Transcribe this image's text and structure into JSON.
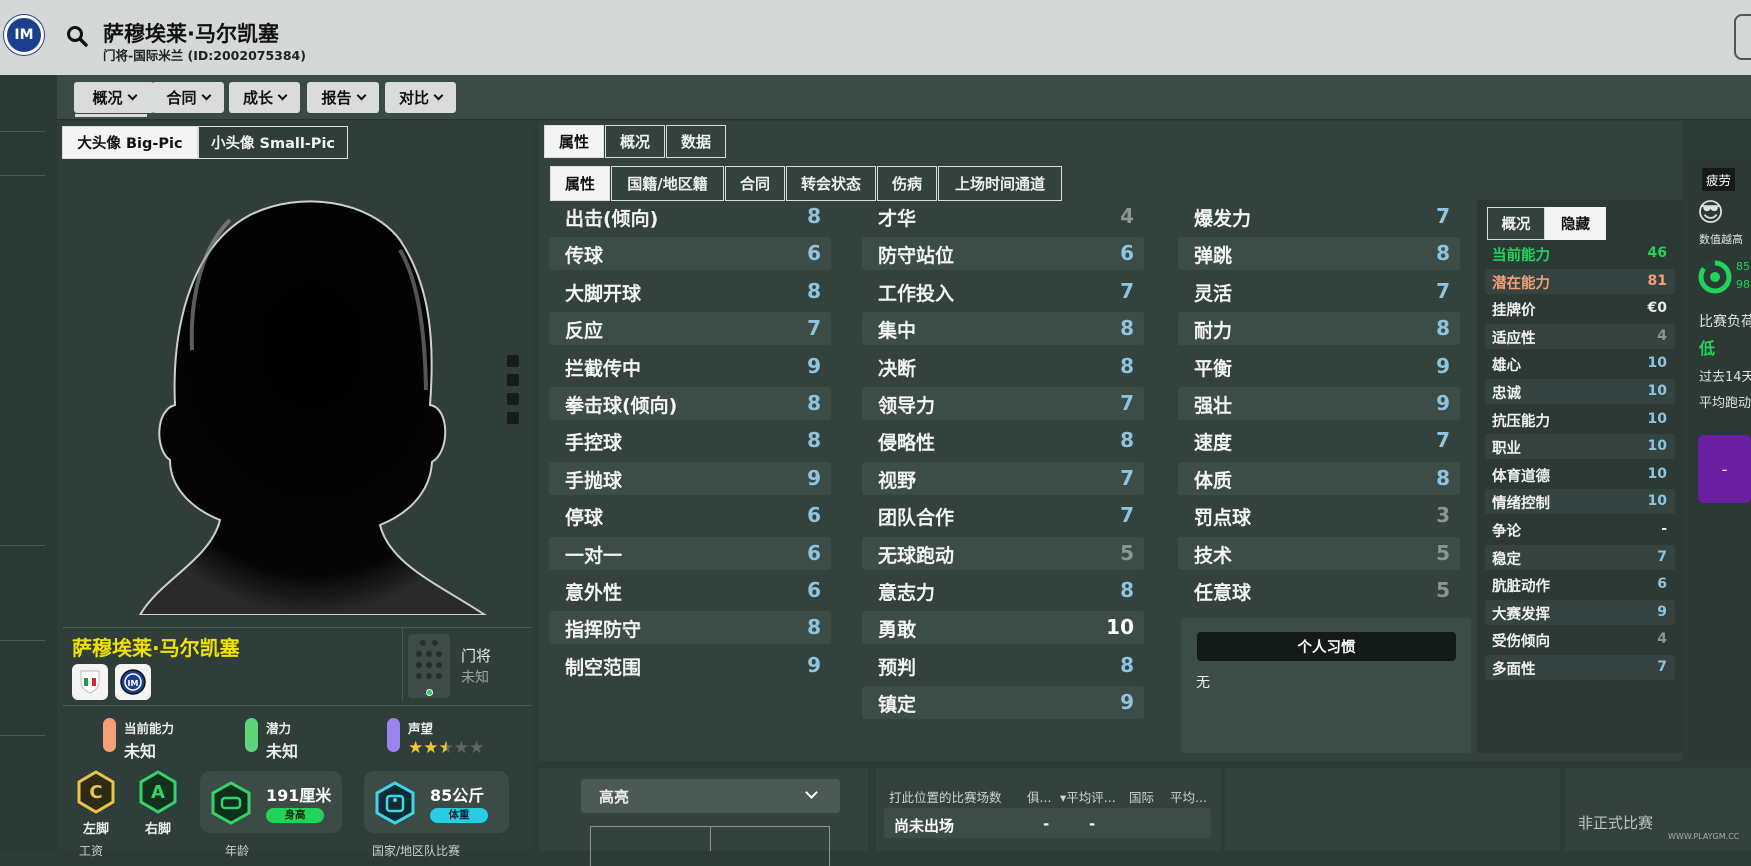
{
  "header": {
    "player_name": "萨穆埃莱·马尔凯塞",
    "subtitle": "门将-国际米兰 (ID:2002075384)"
  },
  "nav": {
    "tabs": [
      {
        "label": "概况"
      },
      {
        "label": "合同"
      },
      {
        "label": "成长"
      },
      {
        "label": "报告"
      },
      {
        "label": "对比"
      }
    ]
  },
  "portrait": {
    "big_pic_label": "大头像 Big-Pic",
    "small_pic_label": "小头像 Small-Pic"
  },
  "player": {
    "name": "萨穆埃莱·马尔凯塞",
    "position": "门将",
    "position_sub": "未知",
    "current_ability_label": "当前能力",
    "current_ability_value": "未知",
    "potential_label": "潜力",
    "potential_value": "未知",
    "reputation_label": "声望",
    "reputation_stars": 2.5,
    "left_foot": "左脚",
    "right_foot": "右脚",
    "height": "191厘米",
    "height_tag": "身高",
    "weight": "85公斤",
    "weight_tag": "体重",
    "bottom_labels": [
      "工资",
      "年龄",
      "国家/地区队比赛"
    ]
  },
  "attr_tabs": {
    "level1": [
      "属性",
      "概况",
      "数据"
    ],
    "level2": [
      "属性",
      "国籍/地区籍",
      "合同",
      "转会状态",
      "伤病",
      "上场时间通道"
    ]
  },
  "attributes": {
    "col1": [
      {
        "name": "出击(倾向)",
        "value": "8"
      },
      {
        "name": "传球",
        "value": "6"
      },
      {
        "name": "大脚开球",
        "value": "8"
      },
      {
        "name": "反应",
        "value": "7"
      },
      {
        "name": "拦截传中",
        "value": "9"
      },
      {
        "name": "拳击球(倾向)",
        "value": "8"
      },
      {
        "name": "手控球",
        "value": "8"
      },
      {
        "name": "手抛球",
        "value": "9"
      },
      {
        "name": "停球",
        "value": "6"
      },
      {
        "name": "一对一",
        "value": "6"
      },
      {
        "name": "意外性",
        "value": "6"
      },
      {
        "name": "指挥防守",
        "value": "8"
      },
      {
        "name": "制空范围",
        "value": "9"
      }
    ],
    "col2": [
      {
        "name": "才华",
        "value": "4"
      },
      {
        "name": "防守站位",
        "value": "6"
      },
      {
        "name": "工作投入",
        "value": "7"
      },
      {
        "name": "集中",
        "value": "8"
      },
      {
        "name": "决断",
        "value": "8"
      },
      {
        "name": "领导力",
        "value": "7"
      },
      {
        "name": "侵略性",
        "value": "8"
      },
      {
        "name": "视野",
        "value": "7"
      },
      {
        "name": "团队合作",
        "value": "7"
      },
      {
        "name": "无球跑动",
        "value": "5"
      },
      {
        "name": "意志力",
        "value": "8"
      },
      {
        "name": "勇敢",
        "value": "10"
      },
      {
        "name": "预判",
        "value": "8"
      },
      {
        "name": "镇定",
        "value": "9"
      }
    ],
    "col3": [
      {
        "name": "爆发力",
        "value": "7"
      },
      {
        "name": "弹跳",
        "value": "8"
      },
      {
        "name": "灵活",
        "value": "7"
      },
      {
        "name": "耐力",
        "value": "8"
      },
      {
        "name": "平衡",
        "value": "9"
      },
      {
        "name": "强壮",
        "value": "9"
      },
      {
        "name": "速度",
        "value": "7"
      },
      {
        "name": "体质",
        "value": "8"
      },
      {
        "name": "罚点球",
        "value": "3"
      },
      {
        "name": "技术",
        "value": "5"
      },
      {
        "name": "任意球",
        "value": "5"
      }
    ]
  },
  "habits": {
    "title": "个人习惯",
    "value": "无"
  },
  "hidden": {
    "tabs": [
      "概况",
      "隐藏"
    ],
    "rows": [
      {
        "name": "当前能力",
        "value": "46"
      },
      {
        "name": "潜在能力",
        "value": "81"
      },
      {
        "name": "挂牌价",
        "value": "€0"
      },
      {
        "name": "适应性",
        "value": "4"
      },
      {
        "name": "雄心",
        "value": "10"
      },
      {
        "name": "忠诚",
        "value": "10"
      },
      {
        "name": "抗压能力",
        "value": "10"
      },
      {
        "name": "职业",
        "value": "10"
      },
      {
        "name": "体育道德",
        "value": "10"
      },
      {
        "name": "情绪控制",
        "value": "10"
      },
      {
        "name": "争论",
        "value": "-"
      },
      {
        "name": "稳定",
        "value": "7"
      },
      {
        "name": "肮脏动作",
        "value": "6"
      },
      {
        "name": "大赛发挥",
        "value": "9"
      },
      {
        "name": "受伤倾向",
        "value": "4"
      },
      {
        "name": "多面性",
        "value": "7"
      }
    ]
  },
  "right_panel": {
    "fatigue": "疲劳",
    "fatigue_note": "数值越高",
    "ring_vals": [
      "85",
      "98"
    ],
    "load_label": "比赛负荷",
    "load_value": "低",
    "past14": "过去14天",
    "avg_run": "平均跑动",
    "purple_value": "-"
  },
  "bottom": {
    "highlight_label": "高亮",
    "table_headers": [
      "打此位置的比赛场数",
      "俱...",
      "平均评...",
      "国际",
      "平均..."
    ],
    "table_row": [
      "尚未出场",
      "-",
      "-"
    ],
    "watermark": "非正式比赛",
    "watermark_brand": "WWW.PLAYGM.CC"
  },
  "colors": {
    "accent_yellow": "#f1e200",
    "current_ability_green": "#22d35a",
    "potential_orange": "#f3a07a",
    "attr_value_blue": "#8fc4df"
  }
}
